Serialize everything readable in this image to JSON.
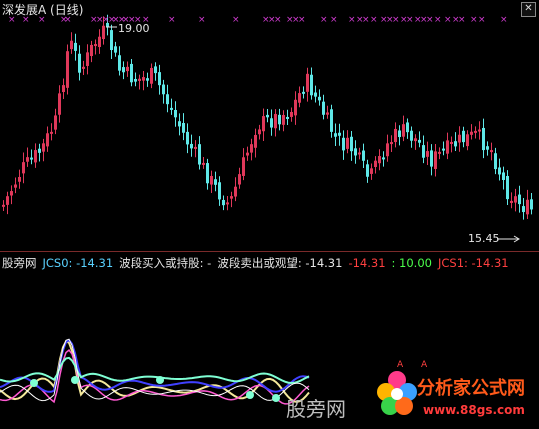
{
  "chart_header": {
    "title": "深发展A (日线)"
  },
  "price_labels": {
    "high": "19.00",
    "low": "15.45"
  },
  "indicator": {
    "source": "股旁网",
    "jcs0": "JCS0: -14.31",
    "buy_hold": "波段买入或持股: -",
    "sell_watch": "波段卖出或观望: -14.31",
    "v1": "-14.31",
    "v2": ": 10.00",
    "jcs1": "JCS1: -14.31"
  },
  "watermark": "股旁网",
  "logo": {
    "title": "分析家公式网",
    "url": "www.88gs.com"
  },
  "colors": {
    "candle_up": "#e0385a",
    "candle_down": "#5fe8e8",
    "signal_x": "#d03cd0",
    "accent_red": "#ff4040",
    "accent_green": "#4cff4c",
    "accent_cyan": "#5ad2ff",
    "accent_white": "#e6e6e6"
  },
  "icons": [
    "close-icon",
    "arrow-right-icon",
    "flower-logo-icon"
  ]
}
